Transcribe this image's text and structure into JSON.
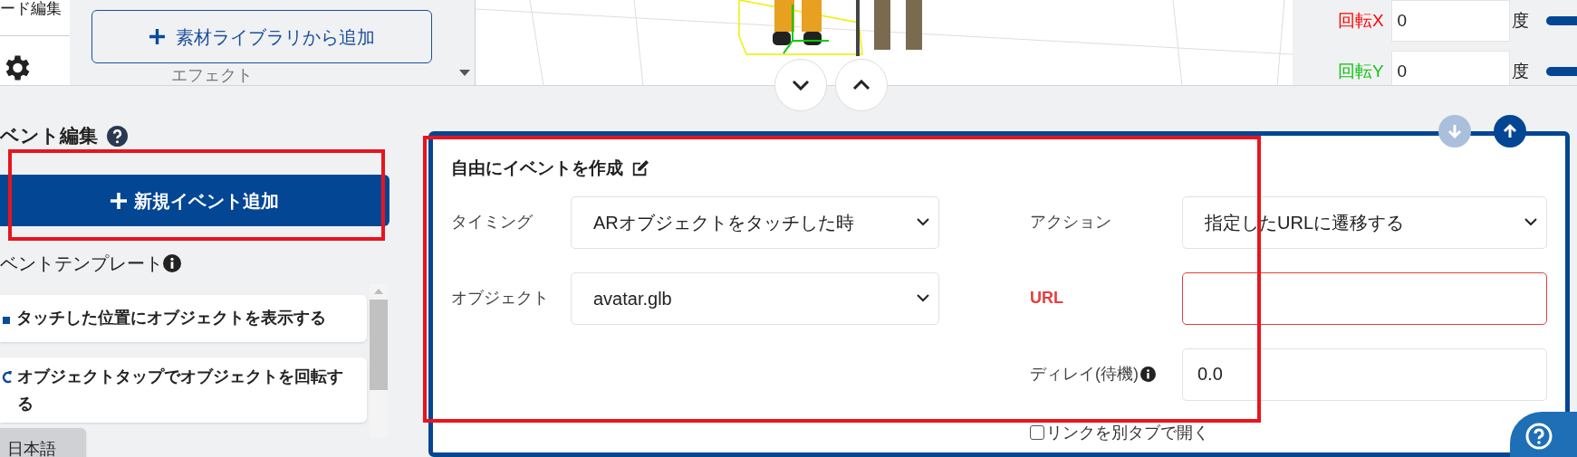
{
  "nav": {
    "label": "ード編集"
  },
  "library": {
    "add_button": "素材ライブラリから追加",
    "section_label": "エフェクト"
  },
  "transform": [
    {
      "label": "回転X",
      "value": "0",
      "unit": "度",
      "color": "#ff0000"
    },
    {
      "label": "回転Y",
      "value": "0",
      "unit": "度",
      "color": "#10c010"
    }
  ],
  "event_editor": {
    "title": "ベント編集",
    "add_button": "新規イベント追加",
    "templates_title": "ベントテンプレート",
    "templates": [
      {
        "kind": "touch",
        "label": "タッチした位置にオブジェクトを表示する"
      },
      {
        "kind": "rotate",
        "label": "オブジェクトタップでオブジェクトを回転する"
      }
    ]
  },
  "language": {
    "label": "日本語"
  },
  "event_card": {
    "title": "自由にイベントを作成",
    "fields_left": [
      {
        "kind": "select",
        "label": "タイミング",
        "value": "ARオブジェクトをタッチした時"
      },
      {
        "kind": "select",
        "label": "オブジェクト",
        "value": "avatar.glb"
      }
    ],
    "fields_right": [
      {
        "kind": "select",
        "label": "アクション",
        "value": "指定したURLに遷移する",
        "invalid": false,
        "info": false
      },
      {
        "kind": "input",
        "label": "URL",
        "invalid": true,
        "info": false
      },
      {
        "kind": "input",
        "label": "ディレイ(待機)",
        "value": "0.0",
        "invalid": false,
        "info": true
      }
    ],
    "new_tab": {
      "label": "リンクを別タブで開く",
      "checked": false
    }
  }
}
